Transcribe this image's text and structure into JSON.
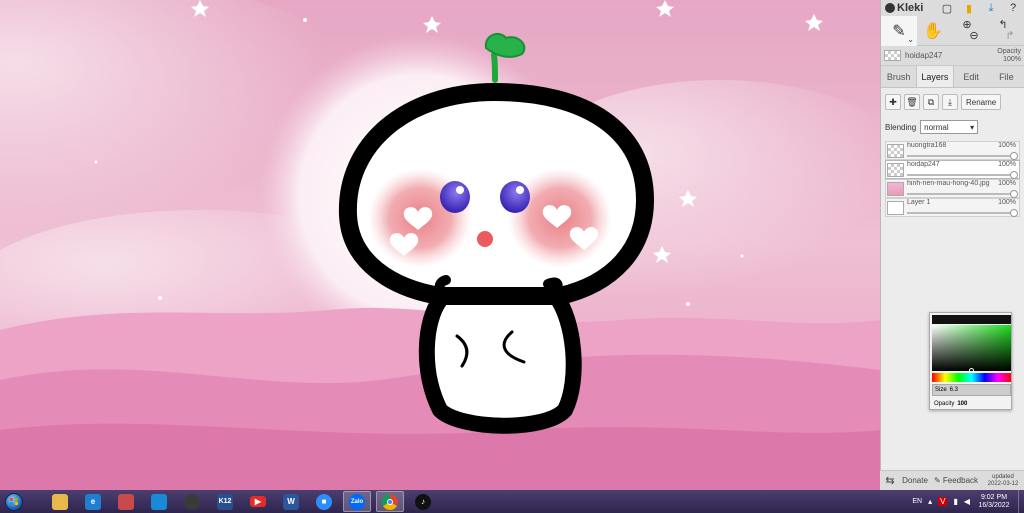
{
  "app": {
    "name": "Kleki",
    "top_icons": [
      "square-icon",
      "file-icon",
      "download-icon",
      "help-icon"
    ]
  },
  "tools": {
    "brush": "brush-icon",
    "hand": "hand-icon",
    "zoom_in": "zoom-in-icon",
    "zoom_out": "zoom-out-icon",
    "undo": "undo-icon",
    "redo": "redo-icon"
  },
  "current_layer": {
    "name": "hoidap247",
    "opacity_label": "Opacity",
    "opacity_value": "100%"
  },
  "tabs": [
    {
      "label": "Brush",
      "active": false
    },
    {
      "label": "Layers",
      "active": true
    },
    {
      "label": "Edit",
      "active": false
    },
    {
      "label": "File",
      "active": false
    }
  ],
  "layers_panel": {
    "rename_label": "Rename",
    "blending_label": "Blending",
    "blending_value": "normal",
    "layers": [
      {
        "name": "huongtra168",
        "opacity": "100%",
        "selected": false,
        "thumb": "checker"
      },
      {
        "name": "hoidap247",
        "opacity": "100%",
        "selected": true,
        "thumb": "checker"
      },
      {
        "name": "hinh-nen-mau-hong-40.jpg",
        "opacity": "100%",
        "selected": false,
        "thumb": "pink"
      },
      {
        "name": "Layer 1",
        "opacity": "100%",
        "selected": false,
        "thumb": "white"
      }
    ]
  },
  "color_picker": {
    "size_label": "Size",
    "size_value": "6.3",
    "opacity_label": "Opacity",
    "opacity_value": "100",
    "current_color": "#1fdc1f"
  },
  "bottom_bar": {
    "donate_label": "Donate",
    "feedback_label": "Feedback",
    "updated_label": "updated",
    "updated_date": "2022-03-12"
  },
  "taskbar": {
    "apps": [
      {
        "name": "file-explorer",
        "label": "",
        "color": "#e7b94a"
      },
      {
        "name": "internet-explorer",
        "label": "e",
        "color": "#1e7fd1"
      },
      {
        "name": "app-calendar",
        "label": "",
        "color": "#c84a4a"
      },
      {
        "name": "windows-store",
        "label": "",
        "color": "#1a8ad8"
      },
      {
        "name": "app-globe",
        "label": "",
        "color": "#3a3a3a"
      },
      {
        "name": "k12",
        "label": "K12",
        "color": "#2a4f8f"
      },
      {
        "name": "youtube",
        "label": "",
        "color": "#e52d27"
      },
      {
        "name": "word",
        "label": "W",
        "color": "#2b579a"
      },
      {
        "name": "zoom",
        "label": "",
        "color": "#2d8cff"
      },
      {
        "name": "zalo",
        "label": "Zalo",
        "color": "#0068ff"
      },
      {
        "name": "chrome",
        "label": "",
        "color": "#dd4b39"
      },
      {
        "name": "tiktok",
        "label": "",
        "color": "#111111"
      }
    ],
    "active_app": "chrome",
    "language": "EN",
    "time": "9:02 PM",
    "date": "16/3/2022"
  },
  "colors": {
    "accent": "#1fdc1f",
    "canvas_bg": "#e7a9c6",
    "sidebar_bg": "#dcdcdc"
  }
}
